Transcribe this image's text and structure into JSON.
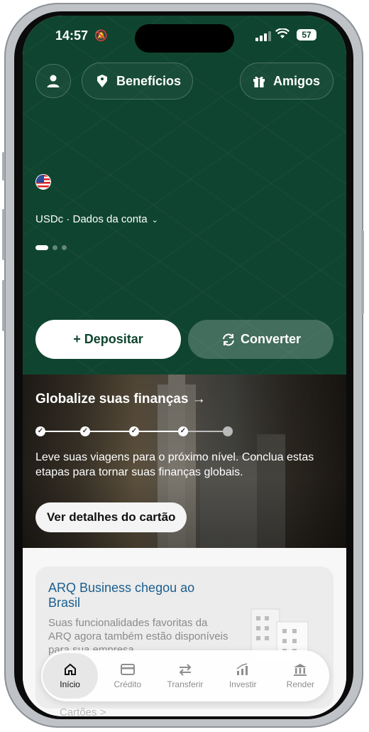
{
  "status_bar": {
    "time": "14:57",
    "battery": "57"
  },
  "header": {
    "benefits_label": "Benefícios",
    "friends_label": "Amigos"
  },
  "account": {
    "label": "USDc · Dados da conta"
  },
  "actions": {
    "deposit_label": "+ Depositar",
    "convert_label": "Converter"
  },
  "promo": {
    "title": "Globalize suas finanças →",
    "text": "Leve suas viagens para o próximo nível. Conclua estas etapas para tornar suas finanças globais.",
    "steps_completed": 4,
    "steps_total": 5,
    "button_label": "Ver detalhes do cartão"
  },
  "business_card": {
    "title": "ARQ Business chegou ao Brasil",
    "text": "Suas funcionalidades favoritas da ARQ agora também estão disponíveis para sua empresa."
  },
  "tabs": [
    {
      "label": "Início",
      "icon": "home-icon",
      "active": true
    },
    {
      "label": "Crédito",
      "icon": "credit-card-icon",
      "active": false
    },
    {
      "label": "Transferir",
      "icon": "transfer-icon",
      "active": false
    },
    {
      "label": "Investir",
      "icon": "chart-icon",
      "active": false
    },
    {
      "label": "Render",
      "icon": "bank-icon",
      "active": false
    }
  ],
  "peek_label": "Cartões >",
  "colors": {
    "brand_green": "#0f4530",
    "link_blue": "#1b5e8f"
  }
}
